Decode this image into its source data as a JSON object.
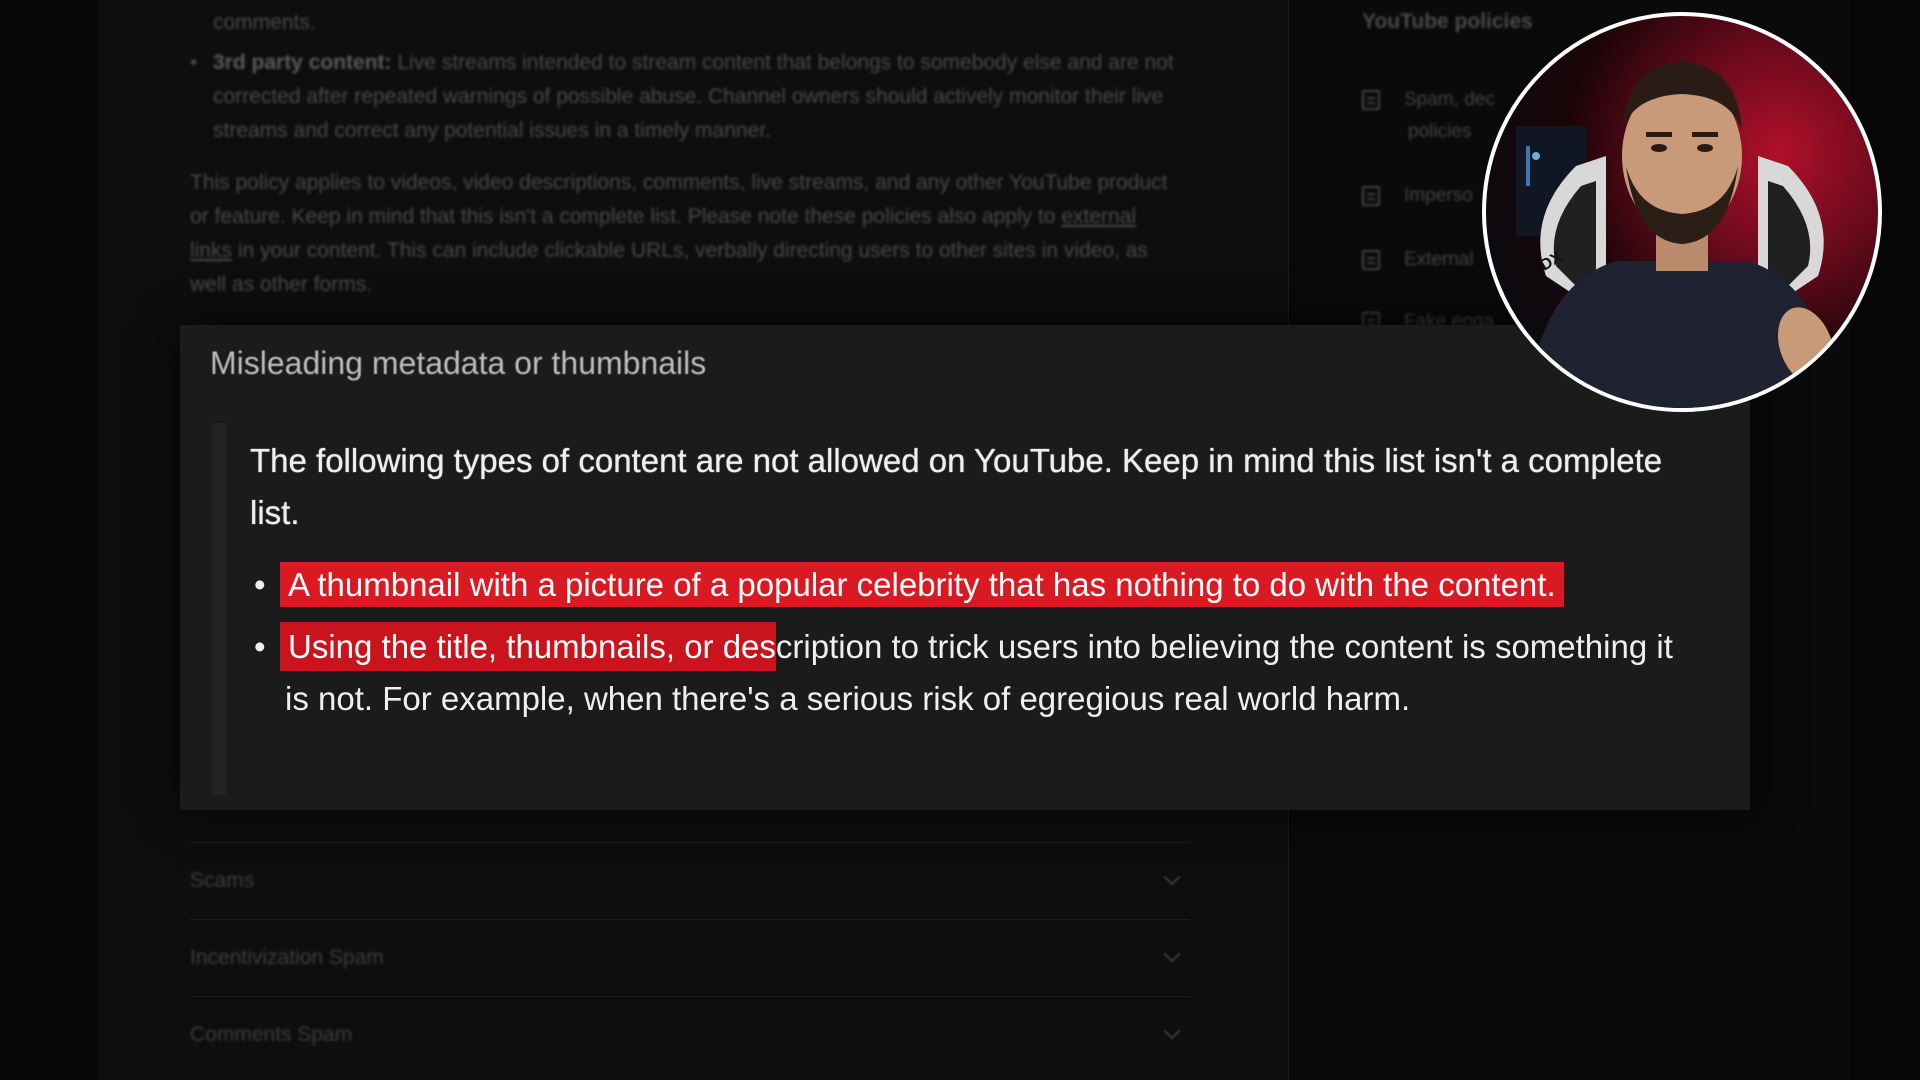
{
  "document": {
    "top_fragment": "comments.",
    "bullet_title": "3rd party content:",
    "bullet_text": "Live streams intended to stream content that belongs to somebody else and are not corrected after repeated warnings of possible abuse. Channel owners should actively monitor their live streams and correct any potential issues in a timely manner.",
    "para_part1": "This policy applies to videos, video descriptions, comments, live streams, and any other YouTube product or feature. Keep in mind that this isn't a complete list. Please note these policies also apply to",
    "para_link": "external links",
    "para_part2": "in your content. This can include clickable URLs, verbally directing users to other sites in video, as well as other forms."
  },
  "sidebar": {
    "title": "YouTube policies",
    "items": [
      {
        "line1": "Spam, dec",
        "line2": "policies"
      },
      {
        "line1": "Imperso"
      },
      {
        "line1": "External"
      },
      {
        "line1": "Fake enga"
      }
    ]
  },
  "panel": {
    "heading": "Misleading metadata or thumbnails",
    "intro": "The following types of content are not allowed on YouTube. Keep in mind this list isn't a complete list.",
    "item1": "A thumbnail with a picture of a popular celebrity that has nothing to do with the content.",
    "item2_highlighted": "Using the title, thumbnails, or des",
    "item2_rest": "cription to trick users into believing the content is something it is not. For example, when there's a serious risk of egregious real world harm."
  },
  "accordion": [
    {
      "label": "Scams"
    },
    {
      "label": "Incentivization Spam"
    },
    {
      "label": "Comments Spam"
    }
  ],
  "colors": {
    "highlight": "#d91a22",
    "panel_bg": "#1b1b1b",
    "webcam_border": "#ffffff"
  },
  "webcam": {
    "chair_text": "DX"
  }
}
